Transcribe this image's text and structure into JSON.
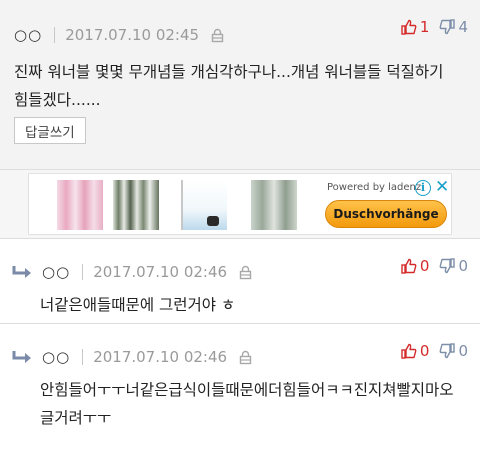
{
  "comments": [
    {
      "nickname": "○○",
      "date": "2017.07.10 02:45",
      "upvotes": "1",
      "downvotes": "4",
      "text": "진짜 워너블 몇몇 무개념들 개심각하구나...개념 워너블들 덕질하기 힘들겠다......",
      "reply_button": "답글쓰기"
    },
    {
      "nickname": "○○",
      "date": "2017.07.10 02:46",
      "upvotes": "0",
      "downvotes": "0",
      "text": "너같은애들때문에 그런거야 ㅎ"
    },
    {
      "nickname": "○○",
      "date": "2017.07.10 02:46",
      "upvotes": "0",
      "downvotes": "0",
      "text": "안힘들어ㅜㅜ너같은급식이들때문에더힘들어ㅋㅋ진지쳐빨지마오글거려ㅜㅜ"
    }
  ],
  "ad": {
    "powered_by": "Powered by ladenz",
    "cta": "Duschvorhänge",
    "info_icon": "i",
    "close_icon": "✕"
  },
  "colors": {
    "upvote": "#d42a2a",
    "downvote": "#7c8ea8",
    "ad_accent": "#1aa0c8",
    "cta": "#f29a0d"
  },
  "icons": [
    "lock-icon",
    "thumbs-up-icon",
    "thumbs-down-icon",
    "reply-arrow-icon",
    "info-icon",
    "close-icon"
  ]
}
